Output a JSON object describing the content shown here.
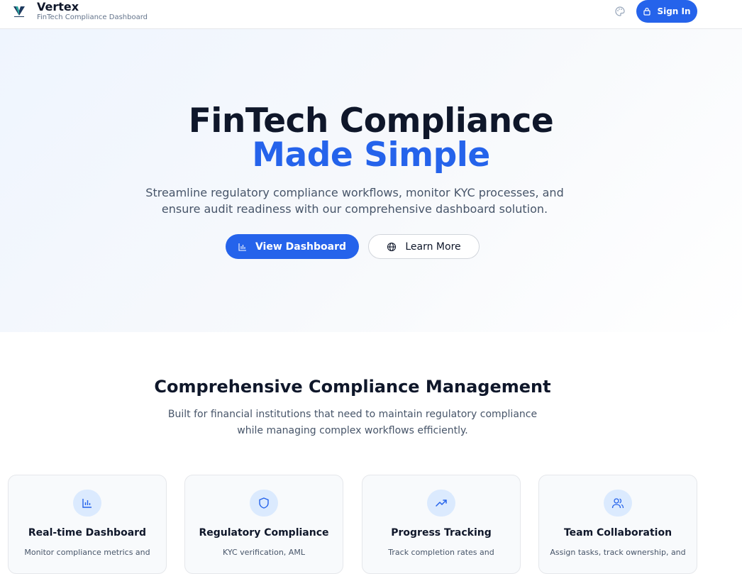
{
  "header": {
    "brand_name": "Vertex",
    "brand_subtitle": "FinTech Compliance Dashboard",
    "signin_label": "Sign In",
    "icons": [
      "vertex-logo",
      "palette-icon",
      "lock-icon"
    ]
  },
  "hero": {
    "title_line1": "FinTech Compliance",
    "title_line2": "Made Simple",
    "description": "Streamline regulatory compliance workflows, monitor KYC processes, and ensure audit readiness with our comprehensive dashboard solution.",
    "primary_button": "View Dashboard",
    "secondary_button": "Learn More"
  },
  "features": {
    "title": "Comprehensive Compliance Management",
    "description": "Built for financial institutions that need to maintain regulatory compliance while managing complex workflows efficiently.",
    "cards": [
      {
        "icon": "bar-chart-icon",
        "title": "Real-time Dashboard",
        "desc": "Monitor compliance metrics and"
      },
      {
        "icon": "shield-icon",
        "title": "Regulatory Compliance",
        "desc": "KYC verification, AML"
      },
      {
        "icon": "trending-up-icon",
        "title": "Progress Tracking",
        "desc": "Track completion rates and"
      },
      {
        "icon": "users-icon",
        "title": "Team Collaboration",
        "desc": "Assign tasks, track ownership, and"
      }
    ]
  },
  "colors": {
    "accent": "#2563eb",
    "text": "#0f172a",
    "muted": "#475569",
    "icon_bg": "#dbeafe"
  }
}
